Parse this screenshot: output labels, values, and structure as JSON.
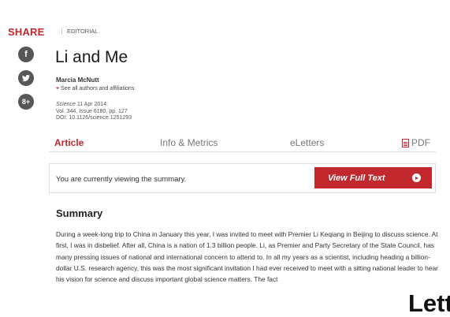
{
  "share": {
    "label": "SHARE",
    "facebook_glyph": "f",
    "google_glyph": "8+"
  },
  "article": {
    "section": "EDITORIAL",
    "title": "Li and Me",
    "author": "Marcia McNutt",
    "affiliations_plus": "+",
    "affiliations_label": "See all authors and affiliations",
    "journal": "Science",
    "date": "11 Apr 2014:",
    "volume": "Vol. 344, Issue 6180, pp. 127",
    "doi": "DOI: 10.1126/science.1251293"
  },
  "tabs": [
    {
      "label": "Article",
      "active": true
    },
    {
      "label": "Info & Metrics",
      "active": false
    },
    {
      "label": "eLetters",
      "active": false
    },
    {
      "label": "PDF",
      "active": false
    }
  ],
  "viewing": {
    "text": "You are currently viewing the summary.",
    "button_label": "View Full Text"
  },
  "summary": {
    "title": "Summary",
    "text": "During a week-long trip to China in January this year, I was invited to meet with Premier Li Keqiang in Beijing to discuss science. At first, I was in disbelief. After all, China is a nation of 1.3 billion people. Li, as Premier and Party Secretary of the State Council, has many pressing issues of national and international concern to attend to. In all my years as a scientist, including heading a billion-dollar U.S. research agency, this was the most significant invitation I had ever received to meet with a sitting national leader to hear his vision for science and discuss important global science matters. The fact"
  },
  "edge_text": "Lett",
  "colors": {
    "accent": "#c2272d",
    "share_icon_bg": "#575757"
  },
  "icons": [
    "facebook-icon",
    "twitter-icon",
    "google-plus-icon",
    "pdf-icon",
    "arrow-right-icon"
  ]
}
